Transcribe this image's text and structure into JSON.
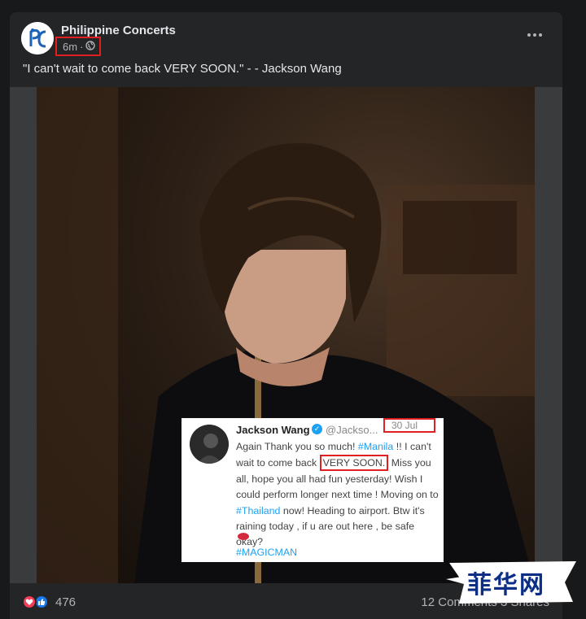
{
  "post": {
    "page_name": "Philippine Concerts",
    "timestamp": "6m",
    "separator": "·",
    "privacy_icon": "globe-icon",
    "caption": "\"I can't wait to come back VERY SOON.\" - - Jackson Wang",
    "more_icon": "more-options-icon"
  },
  "tweet": {
    "name": "Jackson Wang",
    "handle": "@Jackso...",
    "date": "30 Jul",
    "text_parts": {
      "p1": "Again Thank you so much! ",
      "tag1": "#Manila",
      "p2": " !! I can't wait to come back ",
      "highlight": "VERY SOON.",
      "p3": " Miss you all, hope you all had fun yesterday! Wish I could perform longer next time ! Moving on to ",
      "tag2": "#Thailand",
      "p4": " now! Heading to airport. Btw it's raining today , if u are out here , be safe okay?"
    },
    "hashtag": "#MAGICMAN"
  },
  "footer": {
    "reaction_count": "476",
    "comments": "12 Comments  3 Shares"
  },
  "watermark": {
    "text": "菲华网"
  },
  "colors": {
    "page_bg": "#18191a",
    "card_bg": "#242526",
    "highlight_box": "#e02020",
    "twitter_blue": "#1da1f2",
    "watermark_blue": "#0c2e85"
  }
}
